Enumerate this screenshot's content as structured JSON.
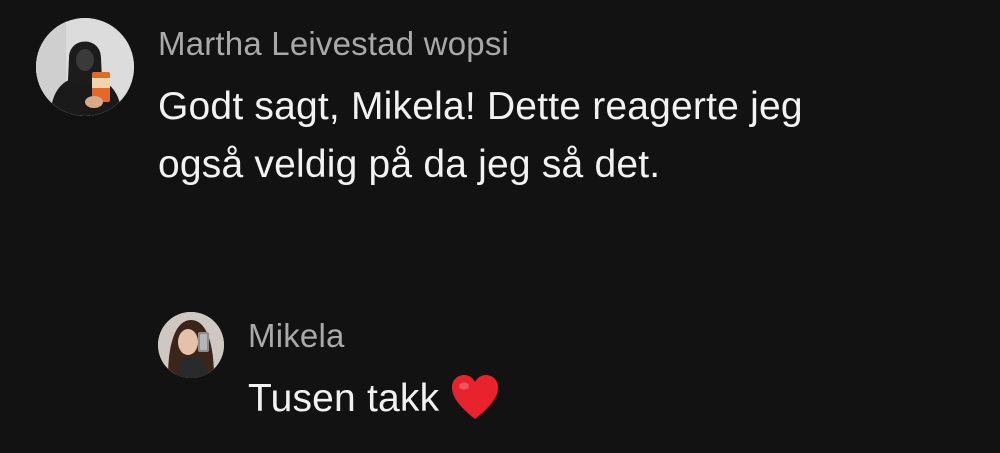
{
  "comments": [
    {
      "username": "Martha Leivestad wopsi",
      "line1": "Godt sagt, Mikela! Dette reagerte jeg",
      "line2": "også veldig på da jeg så det."
    },
    {
      "username": "Mikela",
      "text": "Tusen takk",
      "emoji_icon": "red-heart-icon"
    }
  ],
  "colors": {
    "background": "#121212",
    "username": "#a9a9a9",
    "text": "#f2f2f2",
    "heart": "#e8232d"
  }
}
